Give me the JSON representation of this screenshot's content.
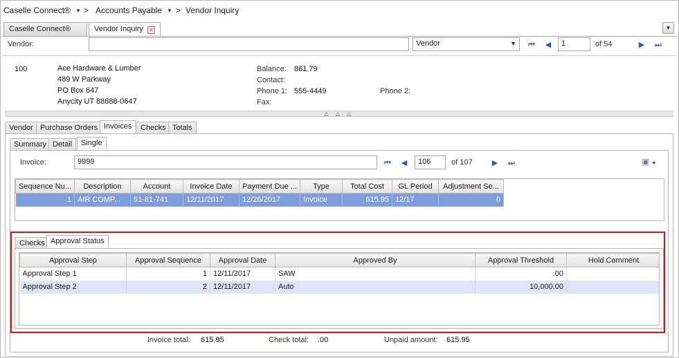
{
  "breadcrumb": {
    "app": "Caselle Connect®",
    "module": "Accounts Payable",
    "page": "Vendor Inquiry",
    "separator": ">"
  },
  "window_tabs": [
    {
      "label": "Caselle Connect®"
    },
    {
      "label": "Vendor Inquiry"
    }
  ],
  "vendor_search": {
    "label": "Vendor:",
    "value": "",
    "lookup_field": "Vendor",
    "record": "1",
    "of_label": "of 54"
  },
  "vendor": {
    "id": "100",
    "name": "Ace Hardware & Lumber",
    "address1": "489 W Parkway",
    "address2": "PO Box 647",
    "city_line": "Anycity UT 88888-0647",
    "balance_label": "Balance:",
    "balance": "861.79",
    "contact_label": "Contact:",
    "contact": "",
    "phone1_label": "Phone 1:",
    "phone1": "555-4449",
    "phone2_label": "Phone 2:",
    "phone2": "",
    "fax_label": "Fax:",
    "fax": ""
  },
  "splitter": "△ △ △",
  "main_tabs": [
    "Vendor",
    "Purchase Orders",
    "Invoices",
    "Checks",
    "Totals"
  ],
  "sub_tabs": [
    "Summary",
    "Detail",
    "Single"
  ],
  "invoice_search": {
    "label": "Invoice:",
    "value": "9999",
    "record": "106",
    "of_label": "of 107"
  },
  "invoice_grid": {
    "columns": [
      "Sequence Nu...",
      "Description",
      "Account",
      "Invoice Date",
      "Payment Due ...",
      "Type",
      "Total Cost",
      "GL Period",
      "Adjustment Se..."
    ],
    "rows": [
      [
        "1",
        "AIR COMP...",
        "51-81-741",
        "12/11/2017",
        "12/26/2017",
        "Invoice",
        "615.95",
        "12/17",
        "0"
      ]
    ]
  },
  "detail_tabs": [
    "Checks",
    "Approval Status"
  ],
  "approval_grid": {
    "columns": [
      "Approval Step",
      "Approval Sequence",
      "Approval Date",
      "Approved By",
      "Approval Threshold",
      "Hold Comment"
    ],
    "rows": [
      [
        "Approval Step 1",
        "1",
        "12/11/2017",
        "SAW",
        ".00",
        ""
      ],
      [
        "Approval Step 2",
        "2",
        "12/11/2017",
        "Auto",
        "10,000.00",
        ""
      ]
    ]
  },
  "totals": {
    "invoice_total_label": "Invoice total:",
    "invoice_total": "615.95",
    "check_total_label": "Check total:",
    "check_total": ".00",
    "unpaid_label": "Unpaid amount:",
    "unpaid": "615.95"
  },
  "icons": {
    "first": "first-record-icon",
    "prev": "previous-record-icon",
    "next": "next-record-icon",
    "last": "last-record-icon",
    "export": "export-menu-icon",
    "close": "close-tab-icon"
  },
  "colors": {
    "selected_row": "#7f9ddb",
    "alt_row": "#dce6f6",
    "highlight_border": "#e01010",
    "nav_arrow": "#1f5fbf"
  }
}
